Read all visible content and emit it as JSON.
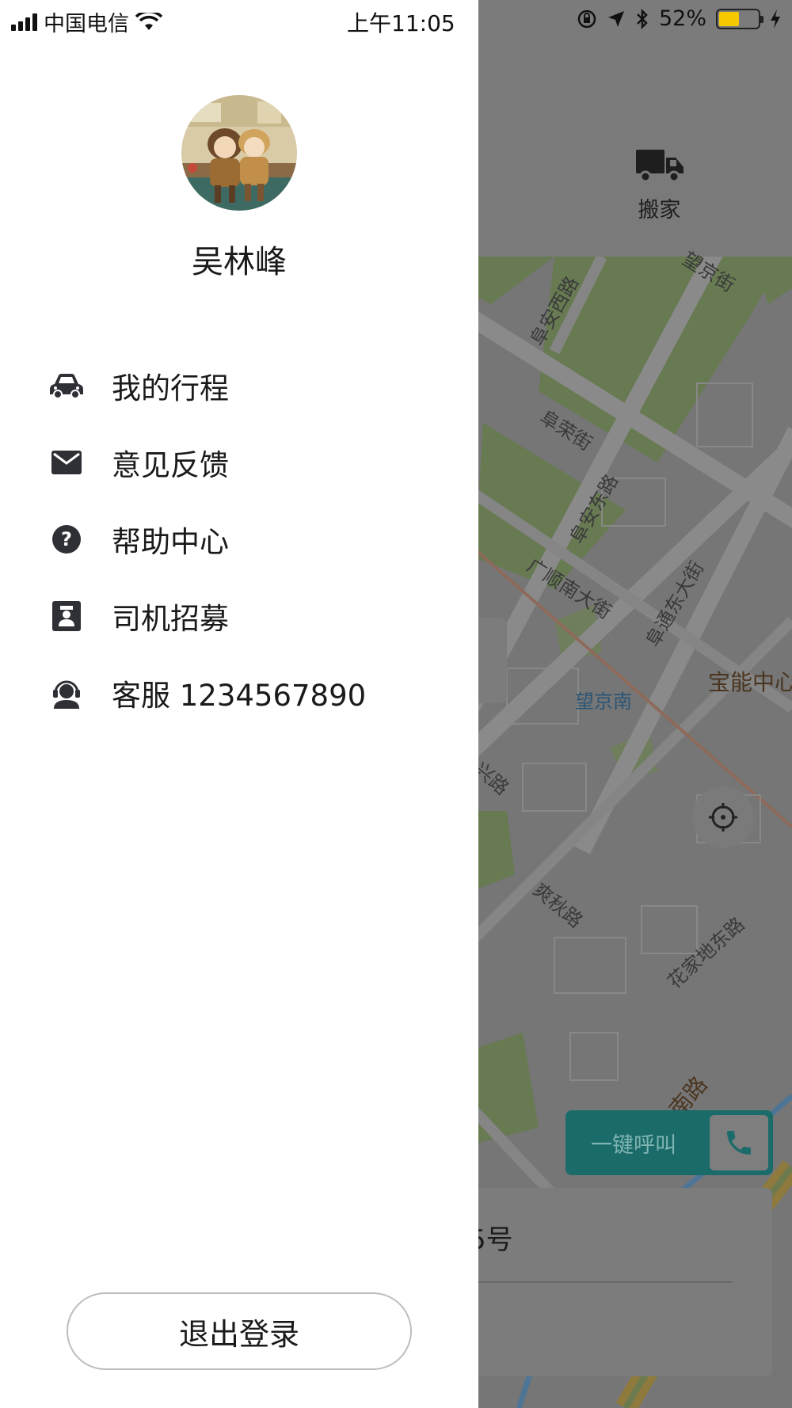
{
  "status_bar": {
    "carrier": "中国电信",
    "time": "上午11:05",
    "battery": "52%",
    "battery_level": 0.52,
    "battery_color": "#f6c800"
  },
  "drawer": {
    "user_name": "吴林峰",
    "menu": [
      {
        "label": "我的行程",
        "icon": "car-icon"
      },
      {
        "label": "意见反馈",
        "icon": "mail-icon"
      },
      {
        "label": "帮助中心",
        "icon": "help-icon"
      },
      {
        "label": "司机招募",
        "icon": "driver-icon"
      },
      {
        "label": "客服 1234567890",
        "icon": "headset-icon"
      }
    ],
    "logout_label": "退出登录"
  },
  "background": {
    "category": {
      "label": "搬家",
      "icon": "truck-icon"
    },
    "map": {
      "roads": [
        "阜安西路",
        "阜荣街",
        "阜安东路",
        "广顺南大街",
        "阜通东大街",
        "望京街",
        "兴路",
        "爽秋路",
        "花家地东路",
        "南路"
      ],
      "poi": "宝能中心",
      "station": "望京南"
    },
    "call_button": "一键呼叫",
    "address_fragment": "5号",
    "accent_color": "#1a6b69"
  }
}
